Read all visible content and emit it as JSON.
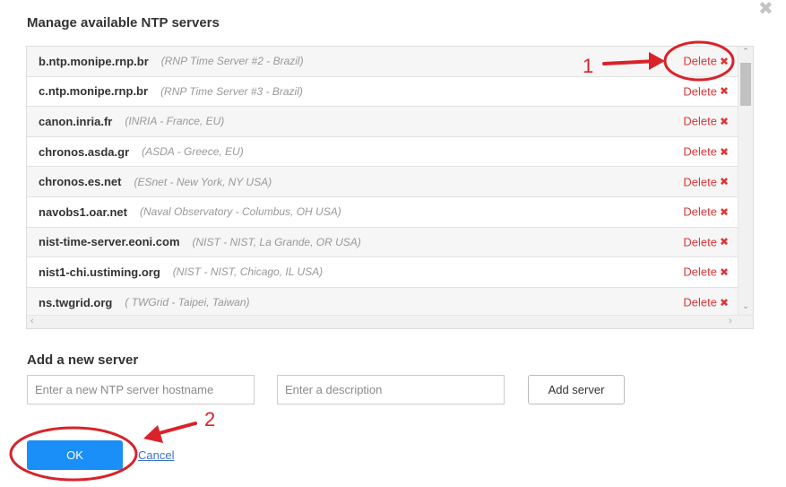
{
  "dialog": {
    "title": "Manage available NTP servers",
    "close_glyph": "✖"
  },
  "servers": [
    {
      "host": "b.ntp.monipe.rnp.br",
      "desc": "(RNP Time Server #2 - Brazil)"
    },
    {
      "host": "c.ntp.monipe.rnp.br",
      "desc": "(RNP Time Server #3 - Brazil)"
    },
    {
      "host": "canon.inria.fr",
      "desc": "(INRIA - France, EU)"
    },
    {
      "host": "chronos.asda.gr",
      "desc": "(ASDA - Greece, EU)"
    },
    {
      "host": "chronos.es.net",
      "desc": "(ESnet - New York, NY USA)"
    },
    {
      "host": "navobs1.oar.net",
      "desc": "(Naval Observatory - Columbus, OH USA)"
    },
    {
      "host": "nist-time-server.eoni.com",
      "desc": "(NIST - NIST, La Grande, OR USA)"
    },
    {
      "host": "nist1-chi.ustiming.org",
      "desc": "(NIST - NIST, Chicago, IL USA)"
    },
    {
      "host": "ns.twgrid.org",
      "desc": "( TWGrid - Taipei, Taiwan)"
    }
  ],
  "row_action": {
    "delete_label": "Delete",
    "delete_glyph": "✖"
  },
  "add_section": {
    "title": "Add a new server",
    "hostname_placeholder": "Enter a new NTP server hostname",
    "description_placeholder": "Enter a description",
    "add_button": "Add server"
  },
  "footer": {
    "ok_label": "OK",
    "cancel_label": "Cancel"
  },
  "annotations": {
    "marker_1": "1",
    "marker_2": "2",
    "color": "#d8232a"
  },
  "colors": {
    "primary": "#1a8ff7",
    "delete": "#d9383a",
    "link": "#3a73c8"
  }
}
